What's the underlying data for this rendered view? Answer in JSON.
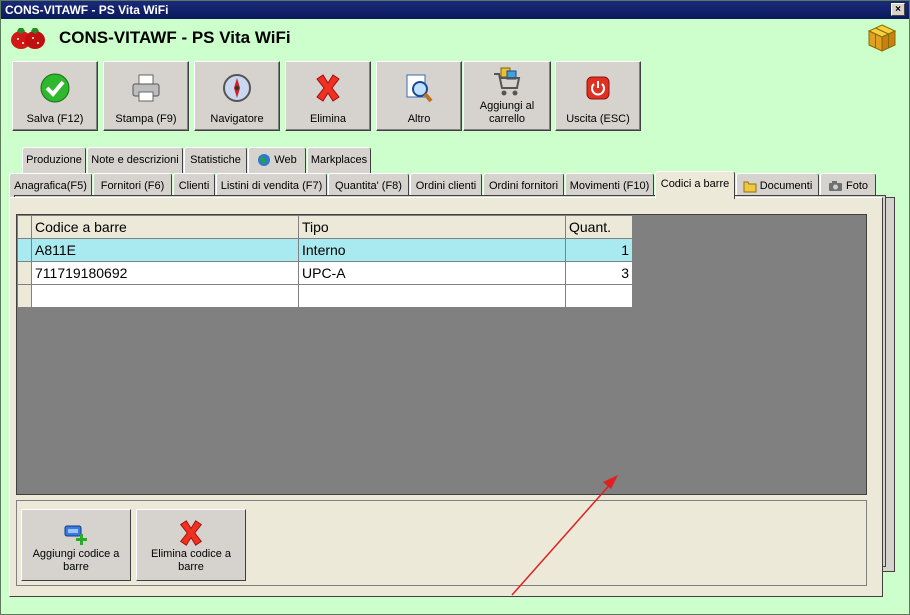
{
  "window": {
    "title": "CONS-VITAWF - PS Vita WiFi",
    "close_label": "×"
  },
  "header": {
    "title": "CONS-VITAWF - PS Vita WiFi"
  },
  "toolbar": [
    {
      "label": "Salva (F12)"
    },
    {
      "label": "Stampa (F9)"
    },
    {
      "label": "Navigatore"
    },
    {
      "label": "Elimina"
    },
    {
      "label": "Altro"
    },
    {
      "label": "Aggiungi al carrello"
    },
    {
      "label": "Uscita (ESC)"
    }
  ],
  "tabs_top": [
    {
      "label": "Produzione"
    },
    {
      "label": "Note e descrizioni"
    },
    {
      "label": "Statistiche"
    },
    {
      "label": "Web"
    },
    {
      "label": "Markplaces"
    }
  ],
  "tabs_bottom": [
    {
      "label": "Anagrafica(F5)"
    },
    {
      "label": "Fornitori (F6)"
    },
    {
      "label": "Clienti"
    },
    {
      "label": "Listini di vendita (F7)"
    },
    {
      "label": "Quantita' (F8)"
    },
    {
      "label": "Ordini clienti"
    },
    {
      "label": "Ordini fornitori"
    },
    {
      "label": "Movimenti (F10)"
    },
    {
      "label": "Codici a barre"
    },
    {
      "label": "Documenti"
    },
    {
      "label": "Foto"
    }
  ],
  "grid": {
    "columns": [
      "Codice a barre",
      "Tipo",
      "Quant."
    ],
    "rows": [
      {
        "code": "A811E",
        "type": "Interno",
        "qty": "1"
      },
      {
        "code": "711719180692",
        "type": "UPC-A",
        "qty": "3"
      },
      {
        "code": "",
        "type": "",
        "qty": ""
      }
    ]
  },
  "actions": [
    {
      "label": "Aggiungi codice a barre"
    },
    {
      "label": "Elimina codice a barre"
    }
  ],
  "colors": {
    "background": "#ccffcc",
    "selected_row": "#a8eaf0",
    "annotation_arrow": "#e02020"
  }
}
